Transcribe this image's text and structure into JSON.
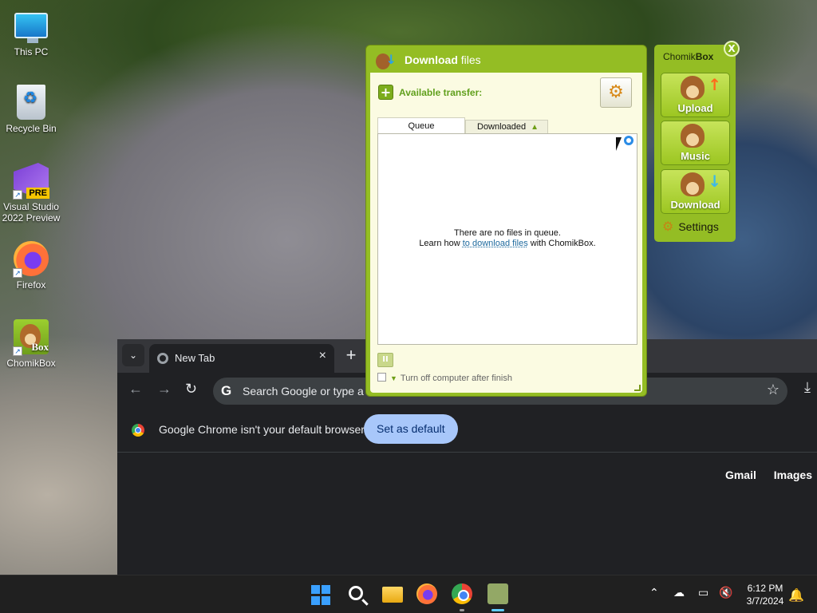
{
  "desktop": {
    "icons": [
      {
        "label": "This PC"
      },
      {
        "label": "Recycle Bin"
      },
      {
        "label": "Visual Studio 2022 Preview",
        "badge": "PRE"
      },
      {
        "label": "Firefox"
      },
      {
        "label": "ChomikBox",
        "badge": "Box"
      }
    ]
  },
  "chrome": {
    "tab_title": "New Tab",
    "omnibox_text": "Search Google or type a",
    "infobar_message": "Google Chrome isn't your default browser",
    "set_default_label": "Set as default",
    "links": [
      "Gmail",
      "Images"
    ]
  },
  "download_window": {
    "title_bold": "Download",
    "title_rest": " files",
    "available_transfer_label": "Available transfer:",
    "tabs": [
      "Queue",
      "Downloaded"
    ],
    "empty_line1": "There are no files in queue.",
    "empty_prefix": "Learn how ",
    "empty_link": "to download files",
    "empty_suffix": " with ChomikBox.",
    "turn_off_label": "Turn off computer after finish"
  },
  "chomikbox_panel": {
    "title_prefix": "Chomik",
    "title_bold": "Box",
    "close_label": "X",
    "buttons": [
      {
        "label": "Upload",
        "arrow": "up",
        "color": "#ff6a1a"
      },
      {
        "label": "Music",
        "arrow": "none"
      },
      {
        "label": "Download",
        "arrow": "down",
        "color": "#3db8e8"
      }
    ],
    "settings_label": "Settings"
  },
  "taskbar": {
    "apps": [
      "start-icon",
      "search-icon",
      "file-explorer-icon",
      "firefox-icon",
      "chrome-icon",
      "chomikbox-icon"
    ],
    "time": "6:12 PM",
    "date": "3/7/2024"
  }
}
